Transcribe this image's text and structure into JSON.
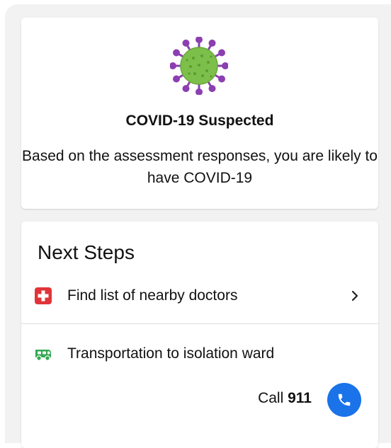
{
  "result": {
    "title": "COVID-19 Suspected",
    "description": "Based on the assessment responses, you are likely to have COVID-19",
    "icon": "virus-icon"
  },
  "next_steps": {
    "title": "Next Steps",
    "items": [
      {
        "label": "Find list of nearby doctors",
        "icon": "medical-cross-icon",
        "action_icon": "chevron-right-icon"
      },
      {
        "label": "Transportation to isolation ward",
        "icon": "ambulance-icon"
      }
    ],
    "call": {
      "prefix": "Call",
      "number": "911",
      "icon": "phone-icon"
    }
  },
  "colors": {
    "background": "#f2f2f2",
    "card": "#ffffff",
    "virus_body": "#7cbf4a",
    "virus_spikes": "#8b3fb0",
    "medical_red": "#e0343a",
    "ambulance_green": "#35a853",
    "call_blue": "#1a73e8",
    "divider": "#dddddd"
  }
}
